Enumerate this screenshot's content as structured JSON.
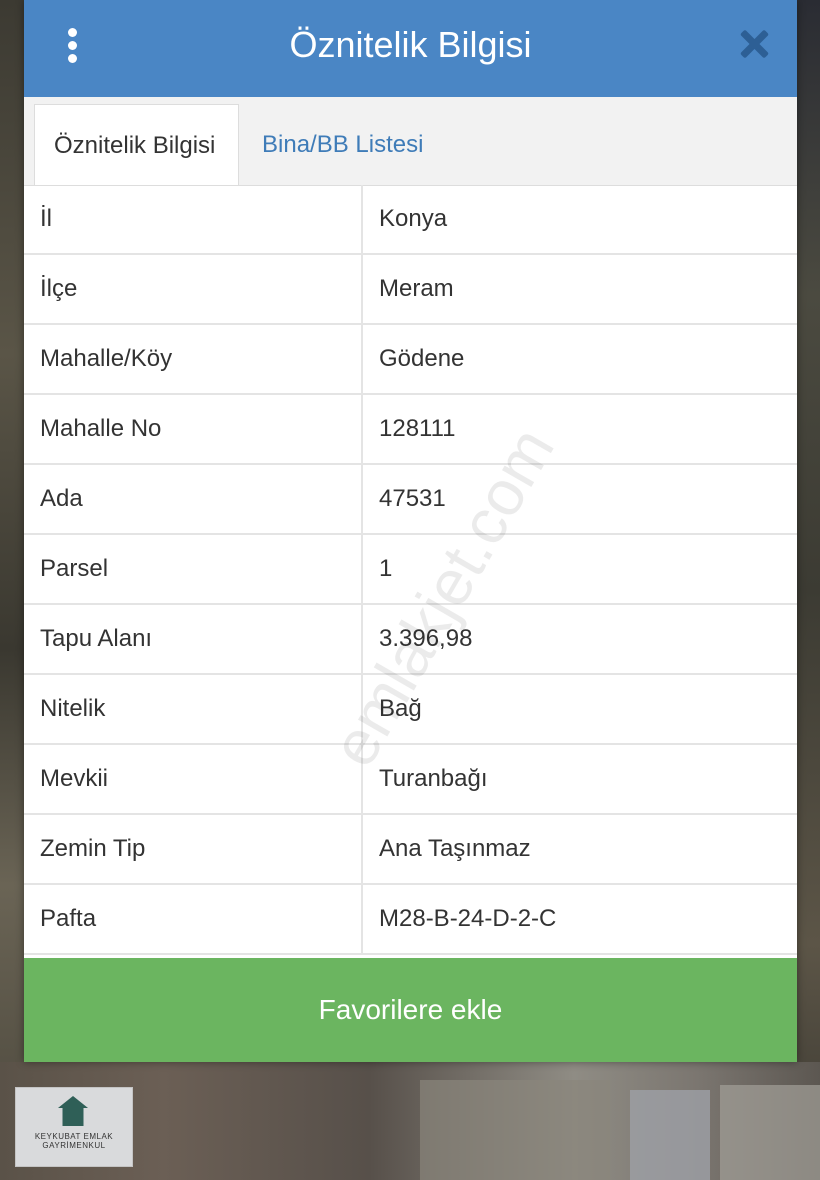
{
  "dialog": {
    "title": "Öznitelik Bilgisi",
    "tabs": [
      {
        "label": "Öznitelik Bilgisi",
        "active": true
      },
      {
        "label": "Bina/BB Listesi",
        "active": false
      }
    ],
    "rows": [
      {
        "key": "İl",
        "value": "Konya"
      },
      {
        "key": "İlçe",
        "value": "Meram"
      },
      {
        "key": "Mahalle/Köy",
        "value": "Gödene"
      },
      {
        "key": "Mahalle No",
        "value": "128111"
      },
      {
        "key": "Ada",
        "value": "47531"
      },
      {
        "key": "Parsel",
        "value": "1"
      },
      {
        "key": "Tapu Alanı",
        "value": "3.396,98"
      },
      {
        "key": "Nitelik",
        "value": "Bağ"
      },
      {
        "key": "Mevkii",
        "value": "Turanbağı"
      },
      {
        "key": "Zemin Tip",
        "value": "Ana Taşınmaz"
      },
      {
        "key": "Pafta",
        "value": "M28-B-24-D-2-C"
      }
    ],
    "favorite_button_label": "Favorilere ekle"
  },
  "watermark": "emlakjet.com",
  "logo": {
    "name": "KEYKUBAT EMLAK GAYRİMENKUL"
  },
  "colors": {
    "header": "#4a86c5",
    "tab_link": "#3f7cb8",
    "button": "#6bb560"
  }
}
